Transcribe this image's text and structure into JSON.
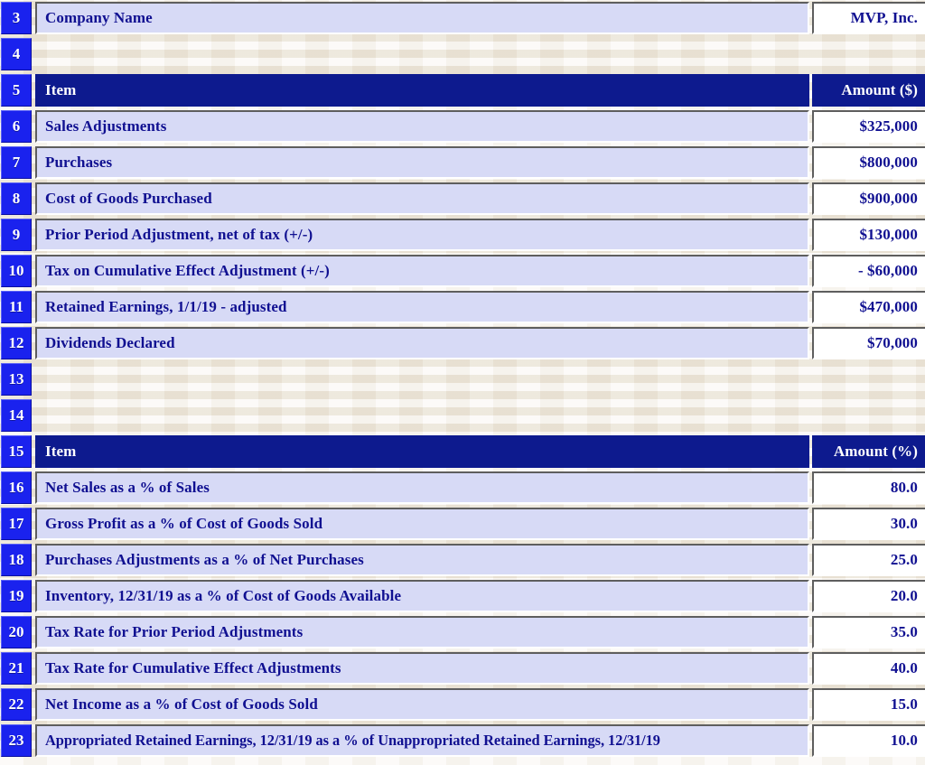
{
  "spreadsheet": {
    "first_visible_row": 3,
    "last_visible_row": 23,
    "row_numbers": [
      "3",
      "4",
      "5",
      "6",
      "7",
      "8",
      "9",
      "10",
      "11",
      "12",
      "13",
      "14",
      "15",
      "16",
      "17",
      "18",
      "19",
      "20",
      "21",
      "22",
      "23"
    ],
    "colors": {
      "row_header_blue": "#1a22ee",
      "header_navy": "#0d1a8e",
      "cell_lavender": "#d7daf6",
      "cell_white": "#ffffff",
      "text_navy": "#101091",
      "text_white": "#ffffff",
      "paper_beige": "#f4efe4"
    }
  },
  "title_row": {
    "row": "3",
    "label": "Company Name",
    "value": "MVP, Inc."
  },
  "blank_rows": [
    "4",
    "13",
    "14"
  ],
  "table_dollars": {
    "header": {
      "row": "5",
      "item": "Item",
      "amount": "Amount ($)"
    },
    "rows": [
      {
        "row": "6",
        "item": "Sales Adjustments",
        "amount": "$325,000"
      },
      {
        "row": "7",
        "item": "Purchases",
        "amount": "$800,000"
      },
      {
        "row": "8",
        "item": "Cost of Goods Purchased",
        "amount": "$900,000"
      },
      {
        "row": "9",
        "item": "Prior Period Adjustment, net of tax (+/-)",
        "amount": "$130,000"
      },
      {
        "row": "10",
        "item": "Tax on Cumulative Effect Adjustment (+/-)",
        "amount": "- $60,000"
      },
      {
        "row": "11",
        "item": "Retained Earnings, 1/1/19 - adjusted",
        "amount": "$470,000"
      },
      {
        "row": "12",
        "item": "Dividends Declared",
        "amount": "$70,000"
      }
    ]
  },
  "table_percent": {
    "header": {
      "row": "15",
      "item": "Item",
      "amount": "Amount (%)"
    },
    "rows": [
      {
        "row": "16",
        "item": "Net Sales as a % of Sales",
        "amount": "80.0"
      },
      {
        "row": "17",
        "item": "Gross Profit as a % of Cost of Goods Sold",
        "amount": "30.0"
      },
      {
        "row": "18",
        "item": "Purchases Adjustments as a % of Net Purchases",
        "amount": "25.0"
      },
      {
        "row": "19",
        "item": "Inventory, 12/31/19 as a % of Cost of Goods Available",
        "amount": "20.0"
      },
      {
        "row": "20",
        "item": "Tax Rate for Prior Period Adjustments",
        "amount": "35.0"
      },
      {
        "row": "21",
        "item": "Tax Rate for Cumulative Effect Adjustments",
        "amount": "40.0"
      },
      {
        "row": "22",
        "item": "Net Income as a % of Cost of Goods Sold",
        "amount": "15.0"
      },
      {
        "row": "23",
        "item": "Appropriated Retained Earnings, 12/31/19 as a % of Unappropriated Retained Earnings, 12/31/19",
        "amount": "10.0"
      }
    ]
  }
}
